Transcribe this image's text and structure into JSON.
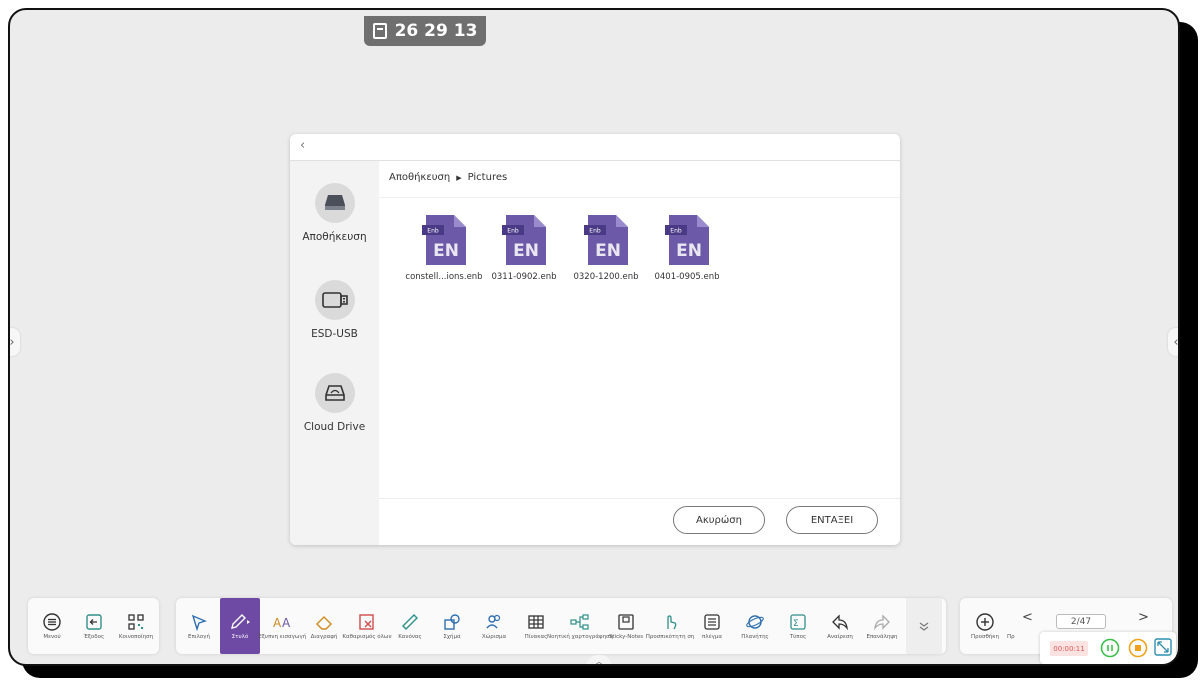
{
  "timer": {
    "value": "26 29 13"
  },
  "dialog": {
    "sidebar": [
      {
        "label": "Αποθήκευση",
        "icon": "storage-drive-icon"
      },
      {
        "label": "ESD-USB",
        "icon": "usb-drive-icon"
      },
      {
        "label": "Cloud Drive",
        "icon": "cloud-drive-icon"
      }
    ],
    "breadcrumb": {
      "root": "Αποθήκευση",
      "separator": "▶",
      "current": "Pictures"
    },
    "files": [
      {
        "name": "constell...ions.enb",
        "badge": "Enb",
        "icon_text": "EN"
      },
      {
        "name": "0311-0902.enb",
        "badge": "Enb",
        "icon_text": "EN"
      },
      {
        "name": "0320-1200.enb",
        "badge": "Enb",
        "icon_text": "EN"
      },
      {
        "name": "0401-0905.enb",
        "badge": "Enb",
        "icon_text": "EN"
      }
    ],
    "cancel_label": "Ακυρώση",
    "ok_label": "ΕΝΤΑΞΕΙ"
  },
  "toolbar": {
    "left": [
      "Μενού",
      "Έξοδος",
      "Κοινοποίηση"
    ],
    "tools": [
      "Επιλογή",
      "Στυλό",
      "Έξυπνη εισαγωγή",
      "Διαγραφή",
      "Καθαρισμός όλων",
      "Κανόνας",
      "Σχήμα",
      "Χώρισμα",
      "Πίνακας",
      "Νοητική χαρτογράφηση",
      "Sticky-Notes",
      "Προσπικότητη ση",
      "πλέγμα",
      "Πλανήτης",
      "Τύπος",
      "Αναίρεση",
      "Επανάληψη"
    ],
    "right": {
      "add_label": "Προσθήκη",
      "extra_label": "Πρ",
      "page": "2/47"
    }
  },
  "recording": {
    "time": "00:00:11"
  },
  "colors": {
    "accent": "#6f4aa5",
    "file_icon": "#6c5aa8",
    "record": "#e05b5b",
    "toolbar_icon": "#2f8f8a"
  }
}
